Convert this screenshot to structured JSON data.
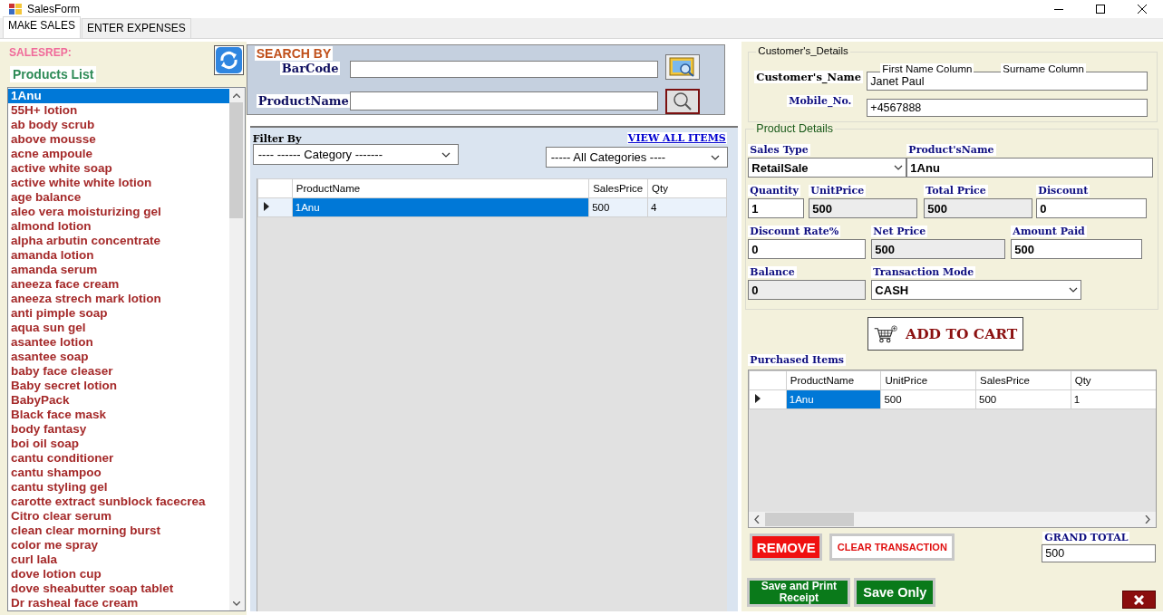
{
  "window": {
    "title": "SalesForm"
  },
  "tabs": [
    {
      "label": "MAkE SALES",
      "selected": true
    },
    {
      "label": "ENTER EXPENSES",
      "selected": false
    }
  ],
  "left": {
    "salesrep_label": "SALESREP:",
    "products_title": "Products List",
    "products": [
      {
        "name": "1Anu",
        "selected": true
      },
      {
        "name": "55H+ lotion",
        "selected": false
      },
      {
        "name": "ab body scrub",
        "selected": false
      },
      {
        "name": "above mousse",
        "selected": false
      },
      {
        "name": "acne ampoule",
        "selected": false
      },
      {
        "name": "active white soap",
        "selected": false
      },
      {
        "name": "active white white lotion",
        "selected": false
      },
      {
        "name": "age balance",
        "selected": false
      },
      {
        "name": "aleo vera moisturizing gel",
        "selected": false
      },
      {
        "name": "almond lotion",
        "selected": false
      },
      {
        "name": "alpha arbutin concentrate",
        "selected": false
      },
      {
        "name": "amanda lotion",
        "selected": false
      },
      {
        "name": "amanda serum",
        "selected": false
      },
      {
        "name": "aneeza face cream",
        "selected": false
      },
      {
        "name": "aneeza strech mark lotion",
        "selected": false
      },
      {
        "name": "anti pimple soap",
        "selected": false
      },
      {
        "name": "aqua sun gel",
        "selected": false
      },
      {
        "name": "asantee lotion",
        "selected": false
      },
      {
        "name": "asantee soap",
        "selected": false
      },
      {
        "name": "baby face cleaser",
        "selected": false
      },
      {
        "name": "Baby secret lotion",
        "selected": false
      },
      {
        "name": "BabyPack",
        "selected": false
      },
      {
        "name": "Black face mask",
        "selected": false
      },
      {
        "name": "body fantasy",
        "selected": false
      },
      {
        "name": "boi oil soap",
        "selected": false
      },
      {
        "name": "cantu conditioner",
        "selected": false
      },
      {
        "name": "cantu shampoo",
        "selected": false
      },
      {
        "name": "cantu styling gel",
        "selected": false
      },
      {
        "name": "carotte extract sunblock facecrea",
        "selected": false
      },
      {
        "name": "Citro clear serum",
        "selected": false
      },
      {
        "name": "clean clear morning burst",
        "selected": false
      },
      {
        "name": "color me spray",
        "selected": false
      },
      {
        "name": "curl lala",
        "selected": false
      },
      {
        "name": "dove lotion cup",
        "selected": false
      },
      {
        "name": "dove sheabutter soap tablet",
        "selected": false
      },
      {
        "name": "Dr rasheal face cream",
        "selected": false
      }
    ]
  },
  "search": {
    "title": "SEARCH BY",
    "barcode_label": "BarCode",
    "productname_label": "ProductName"
  },
  "filter": {
    "label": "Filter By",
    "view_all": "VIEW ALL ITEMS",
    "category_dropdown": "---- ------ Category -------",
    "all_categories_dropdown": "----- All Categories ----"
  },
  "products_table": {
    "columns": [
      "ProductName",
      "SalesPrice",
      "Qty"
    ],
    "rows": [
      {
        "cells": [
          "1Anu",
          "500",
          "4"
        ],
        "selected": true
      }
    ]
  },
  "customer": {
    "title": "Customer's_Details",
    "name_label": "Customer's_Name",
    "first_name_column": "First Name Column",
    "surname_column": "Surname Column",
    "name_value": "Janet Paul",
    "mobile_label": "Mobile_No.",
    "mobile_value": "+4567888"
  },
  "product_details": {
    "title": "Product Details",
    "fields": [
      {
        "label": "Sales Type",
        "value": "RetailSale",
        "kind": "dropdown"
      },
      {
        "label": "Product'sName",
        "value": "1Anu",
        "kind": "input"
      },
      {
        "label": "Quantity",
        "value": "1",
        "kind": "input"
      },
      {
        "label": "UnitPrice",
        "value": "500",
        "kind": "readonly"
      },
      {
        "label": "Total Price",
        "value": "500",
        "kind": "readonly"
      },
      {
        "label": "Discount",
        "value": "0",
        "kind": "input"
      },
      {
        "label": "Discount Rate%",
        "value": "0",
        "kind": "input"
      },
      {
        "label": "Net Price",
        "value": "500",
        "kind": "readonly"
      },
      {
        "label": "Amount Paid",
        "value": "500",
        "kind": "input"
      },
      {
        "label": "Balance",
        "value": "0",
        "kind": "readonly"
      },
      {
        "label": "Transaction Mode",
        "value": "CASH",
        "kind": "dropdown"
      }
    ]
  },
  "add_to_cart": "ADD TO CART",
  "purchased": {
    "title": "Purchased Items",
    "columns": [
      "ProductName",
      "UnitPrice",
      "SalesPrice",
      "Qty"
    ],
    "rows": [
      {
        "cells": [
          "1Anu",
          "500",
          "500",
          "1"
        ],
        "selected": true
      }
    ]
  },
  "buttons": {
    "remove": "REMOVE",
    "clear": "CLEAR TRANSACTION",
    "save_print": "Save and Print Receipt",
    "save_only": "Save Only"
  },
  "grand_total": {
    "label": "GRAND TOTAL",
    "value": "500"
  }
}
